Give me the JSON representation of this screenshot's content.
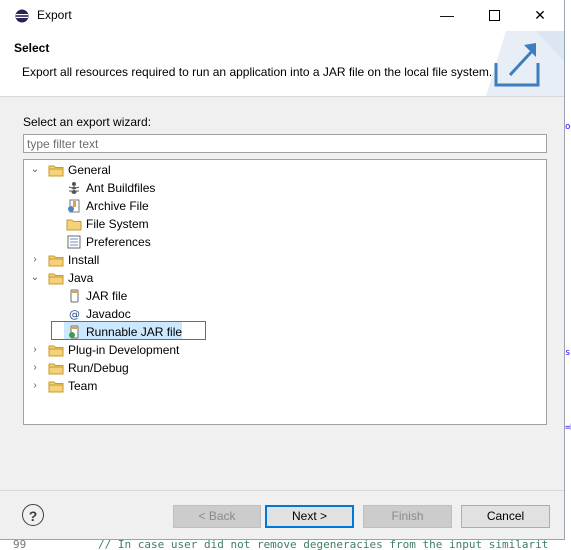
{
  "window": {
    "title": "Export",
    "minimize_glyph": "—",
    "maximize_glyph": "☐",
    "close_glyph": "✕"
  },
  "header": {
    "title": "Select",
    "description": "Export all resources required to run an application into a JAR file on the local file system."
  },
  "wizard": {
    "label": "Select an export wizard:",
    "filter_placeholder": "type filter text",
    "tree": [
      {
        "label": "General",
        "expanded": true,
        "icon": "folder-icon"
      },
      {
        "label": "Ant Buildfiles",
        "icon": "ant-icon"
      },
      {
        "label": "Archive File",
        "icon": "archive-icon"
      },
      {
        "label": "File System",
        "icon": "folder-icon"
      },
      {
        "label": "Preferences",
        "icon": "preferences-icon"
      },
      {
        "label": "Install",
        "expanded": false,
        "icon": "folder-icon"
      },
      {
        "label": "Java",
        "expanded": true,
        "icon": "folder-icon"
      },
      {
        "label": "JAR file",
        "icon": "jar-icon"
      },
      {
        "label": "Javadoc",
        "icon": "javadoc-icon"
      },
      {
        "label": "Runnable JAR file",
        "icon": "runnable-jar-icon",
        "selected": true
      },
      {
        "label": "Plug-in Development",
        "expanded": false,
        "icon": "folder-icon"
      },
      {
        "label": "Run/Debug",
        "expanded": false,
        "icon": "folder-icon"
      },
      {
        "label": "Team",
        "expanded": false,
        "icon": "folder-icon"
      }
    ]
  },
  "buttons": {
    "help": "?",
    "back": "< Back",
    "next": "Next >",
    "finish": "Finish",
    "cancel": "Cancel"
  },
  "editor": {
    "line_number": "99",
    "code": "// In case user did not remove degeneracies from the input similarit"
  },
  "colors": {
    "selection": "#cce8ff",
    "highlight_border": "#e03b3b",
    "default_button_border": "#0078d7",
    "folder": "#e8b54a"
  }
}
